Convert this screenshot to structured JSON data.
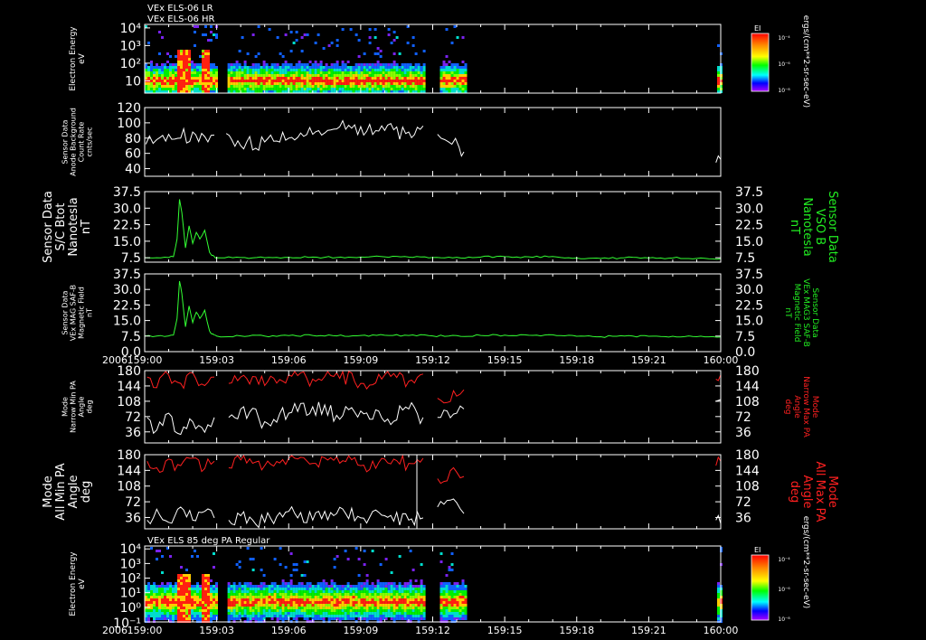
{
  "colors": {
    "background": "#000000",
    "axes": "#ffffff",
    "white_trace": "#ffffff",
    "green_trace": "#33ff33",
    "green_label": "#22ee22",
    "red_trace": "#ff2020",
    "red_label": "#ff2020"
  },
  "chart_data": [
    {
      "id": "p1",
      "type": "heatmap",
      "top_titles": [
        "VEx ELS-06 LR",
        "VEx ELS-06 HR"
      ],
      "ylabel": [
        "Electron Energy",
        "eV"
      ],
      "yscale": "log",
      "yticks": [
        {
          "v": 10,
          "t": "10"
        },
        {
          "v": 100,
          "t": "10²"
        },
        {
          "v": 1000,
          "t": "10³"
        },
        {
          "v": 10000,
          "t": "10⁴"
        }
      ],
      "colorbar": {
        "title": "EI",
        "ticks": [
          "10⁻⁴",
          "10⁻⁶",
          "10⁻⁸"
        ],
        "side_label": "ergs/(cm**2-sr-sec-eV)"
      },
      "data_windows_min": [
        [
          0.0,
          2.95
        ],
        [
          3.45,
          11.6
        ],
        [
          12.3,
          13.4
        ],
        [
          23.85,
          24.0
        ]
      ]
    },
    {
      "id": "p2",
      "type": "line",
      "ylabel": [
        "Sensor Data",
        "Anode Background",
        "Count Rate",
        "cnts/sec"
      ],
      "ylim": [
        30,
        120
      ],
      "yticks": [
        40,
        60,
        80,
        100,
        120
      ],
      "series": [
        {
          "color": "white",
          "segments": [
            {
              "x": [
                0.05,
                0.5,
                1.0,
                1.5,
                2.0,
                2.5,
                2.9
              ],
              "y": [
                72,
                78,
                85,
                80,
                88,
                82,
                84
              ]
            },
            {
              "x": [
                3.4,
                4,
                5,
                6,
                7,
                8,
                9,
                10,
                11,
                11.6
              ],
              "y": [
                86,
                70,
                75,
                80,
                85,
                92,
                95,
                90,
                88,
                96
              ]
            },
            {
              "x": [
                12.2,
                12.5,
                12.8,
                13.1,
                13.3
              ],
              "y": [
                85,
                78,
                72,
                68,
                62
              ]
            },
            {
              "x": [
                23.8,
                24.0
              ],
              "y": [
                48,
                52
              ]
            }
          ]
        }
      ]
    },
    {
      "id": "p3",
      "type": "line",
      "ylabel": [
        "Sensor Data",
        "S/C Btot",
        "Nanotesla",
        "nT"
      ],
      "right_label": [
        "Sensor Data",
        "VSO B",
        "Nanotesla",
        "nT"
      ],
      "ylim": [
        5.5,
        37.5
      ],
      "yticks": [
        {
          "v": 7.5,
          "t": "7.5"
        },
        {
          "v": 15.0,
          "t": "15.0"
        },
        {
          "v": 22.5,
          "t": "22.5"
        },
        {
          "v": 30.0,
          "t": "30.0"
        },
        {
          "v": 37.5,
          "t": "37.5"
        }
      ],
      "series": [
        {
          "color": "green",
          "x": [
            0,
            0.5,
            1.0,
            1.2,
            1.35,
            1.45,
            1.55,
            1.7,
            1.85,
            2.0,
            2.15,
            2.3,
            2.5,
            2.7,
            2.8,
            2.9,
            3.0,
            4,
            5,
            6,
            7,
            8,
            9,
            10,
            11,
            12,
            13,
            14,
            15,
            16,
            17,
            18,
            19,
            20,
            21,
            22,
            23,
            24
          ],
          "y": [
            7.5,
            7.5,
            7.6,
            8,
            16,
            34,
            28,
            12,
            22,
            14,
            19,
            16,
            20,
            10,
            8.5,
            8,
            7.5,
            7.6,
            7.5,
            7.7,
            7.8,
            7.6,
            7.8,
            7.9,
            7.8,
            7.6,
            7.7,
            7.8,
            8.0,
            7.9,
            8.1,
            7.4,
            7.2,
            7.5,
            7.4,
            7.4,
            7.2,
            7.0
          ]
        }
      ]
    },
    {
      "id": "p4",
      "type": "line",
      "ylabel": [
        "Sensor Data",
        "VEx MAG SAF-B",
        "Magnetic Field",
        "nT"
      ],
      "right_label": [
        "Sensor Data",
        "VEx MAG3 SAF-B",
        "Magnetic Field",
        "nT"
      ],
      "ylim": [
        0,
        37.5
      ],
      "yticks": [
        {
          "v": 0,
          "t": "0.0"
        },
        {
          "v": 7.5,
          "t": "7.5"
        },
        {
          "v": 15.0,
          "t": "15.0"
        },
        {
          "v": 22.5,
          "t": "22.5"
        },
        {
          "v": 30.0,
          "t": "30.0"
        },
        {
          "v": 37.5,
          "t": "37.5"
        }
      ],
      "series": [
        {
          "color": "green",
          "x": [
            0,
            0.5,
            1.0,
            1.2,
            1.35,
            1.45,
            1.55,
            1.7,
            1.85,
            2.0,
            2.15,
            2.3,
            2.5,
            2.7,
            2.8,
            2.9,
            3.0,
            4,
            5,
            6,
            7,
            8,
            9,
            10,
            11,
            12,
            13,
            14,
            15,
            16,
            17,
            18,
            19,
            20,
            21,
            22,
            23,
            24
          ],
          "y": [
            7.5,
            7.5,
            7.6,
            8,
            16,
            34,
            28,
            12,
            22,
            14,
            19,
            16,
            20,
            10,
            8.5,
            8,
            7.5,
            7.6,
            7.5,
            7.7,
            7.8,
            7.6,
            7.8,
            7.9,
            7.8,
            7.6,
            7.7,
            7.8,
            8.0,
            7.9,
            8.1,
            7.4,
            7.2,
            7.5,
            7.4,
            7.4,
            7.2,
            7.0
          ]
        }
      ],
      "xticks": [
        "159:00",
        "159:03",
        "159:06",
        "159:09",
        "159:12",
        "159:15",
        "159:18",
        "159:21",
        "160:00"
      ],
      "year": "2006"
    },
    {
      "id": "p5",
      "type": "line",
      "ylabel": [
        "Mode",
        "Narrow Min PA",
        "Angle",
        "deg"
      ],
      "right_label": [
        "Mode",
        "Narrow Max PA",
        "Angle",
        "deg"
      ],
      "ylim": [
        10,
        180
      ],
      "yticks": [
        36,
        72,
        108,
        144,
        180
      ],
      "series": [
        {
          "color": "white",
          "segments": [
            {
              "x": [
                0.1,
                0.5,
                1,
                1.5,
                2,
                2.5,
                2.9
              ],
              "y": [
                70,
                40,
                80,
                30,
                60,
                35,
                70
              ]
            },
            {
              "x": [
                3.5,
                4,
                5,
                6,
                7,
                8,
                9,
                10,
                11,
                11.6
              ],
              "y": [
                70,
                90,
                60,
                80,
                95,
                75,
                85,
                60,
                90,
                70
              ]
            },
            {
              "x": [
                12.2,
                12.6,
                13,
                13.3
              ],
              "y": [
                70,
                85,
                80,
                90
              ]
            },
            {
              "x": [
                23.8,
                24.0
              ],
              "y": [
                108,
                112
              ]
            }
          ]
        },
        {
          "color": "red",
          "segments": [
            {
              "x": [
                0.1,
                0.5,
                1,
                1.5,
                2,
                2.5,
                2.9
              ],
              "y": [
                165,
                140,
                170,
                150,
                175,
                145,
                165
              ]
            },
            {
              "x": [
                3.5,
                4,
                5,
                6,
                7,
                8,
                9,
                10,
                11,
                11.6
              ],
              "y": [
                150,
                165,
                145,
                170,
                160,
                175,
                150,
                170,
                155,
                172
              ]
            },
            {
              "x": [
                12.2,
                12.6,
                13,
                13.3
              ],
              "y": [
                115,
                105,
                120,
                135
              ]
            },
            {
              "x": [
                23.8,
                24.0
              ],
              "y": [
                160,
                170
              ]
            }
          ]
        }
      ]
    },
    {
      "id": "p6",
      "type": "line",
      "ylabel": [
        "Mode",
        "All Min PA",
        "Angle",
        "deg"
      ],
      "right_label": [
        "Mode",
        "All Max PA",
        "Angle",
        "deg"
      ],
      "ylim": [
        10,
        180
      ],
      "yticks": [
        36,
        72,
        108,
        144,
        180
      ],
      "series": [
        {
          "color": "white",
          "segments": [
            {
              "x": [
                0.1,
                0.5,
                1,
                1.5,
                2,
                2.5,
                2.9
              ],
              "y": [
                30,
                55,
                25,
                60,
                30,
                50,
                35
              ]
            },
            {
              "x": [
                3.5,
                4,
                5,
                6,
                7,
                8,
                9,
                10,
                11,
                11.6
              ],
              "y": [
                30,
                40,
                25,
                50,
                30,
                45,
                35,
                40,
                30,
                35
              ]
            },
            {
              "x": [
                12.2,
                12.6,
                13,
                13.3
              ],
              "y": [
                60,
                75,
                70,
                45
              ]
            },
            {
              "x": [
                23.8,
                24.0
              ],
              "y": [
                30,
                22
              ]
            }
          ]
        },
        {
          "color": "red",
          "segments": [
            {
              "x": [
                0.1,
                0.5,
                1,
                1.5,
                2,
                2.5,
                2.9
              ],
              "y": [
                165,
                150,
                170,
                155,
                172,
                148,
                165
              ]
            },
            {
              "x": [
                3.5,
                4,
                5,
                6,
                7,
                8,
                9,
                10,
                11,
                11.6
              ],
              "y": [
                150,
                168,
                155,
                172,
                160,
                175,
                155,
                170,
                160,
                172
              ]
            },
            {
              "x": [
                12.2,
                12.6,
                13,
                13.3
              ],
              "y": [
                125,
                120,
                140,
                130
              ]
            },
            {
              "x": [
                23.8,
                24.0
              ],
              "y": [
                155,
                165
              ]
            }
          ]
        }
      ]
    },
    {
      "id": "p7",
      "type": "heatmap",
      "top_titles": [
        "VEx ELS 85 deg PA Regular"
      ],
      "ylabel": [
        "Electron Energy",
        "eV"
      ],
      "yscale": "log",
      "yticks": [
        {
          "v": 1,
          "t": "10⁰"
        },
        {
          "v": 10,
          "t": "10¹"
        },
        {
          "v": 100,
          "t": "10²"
        },
        {
          "v": 1000,
          "t": "10³"
        },
        {
          "v": 10000,
          "t": "10⁴"
        }
      ],
      "bottom_tick": "10⁻¹",
      "colorbar": {
        "title": "EI",
        "ticks": [
          "10⁻⁴",
          "10⁻⁶",
          "10⁻⁸"
        ],
        "side_label": "ergs/(cm**2-sr-sec-eV)"
      },
      "data_windows_min": [
        [
          0.0,
          2.95
        ],
        [
          3.45,
          11.6
        ],
        [
          12.3,
          13.4
        ],
        [
          23.85,
          24.0
        ]
      ],
      "xticks": [
        "159:00",
        "159:03",
        "159:06",
        "159:09",
        "159:12",
        "159:15",
        "159:18",
        "159:21",
        "160:00"
      ],
      "year": "2006"
    }
  ]
}
